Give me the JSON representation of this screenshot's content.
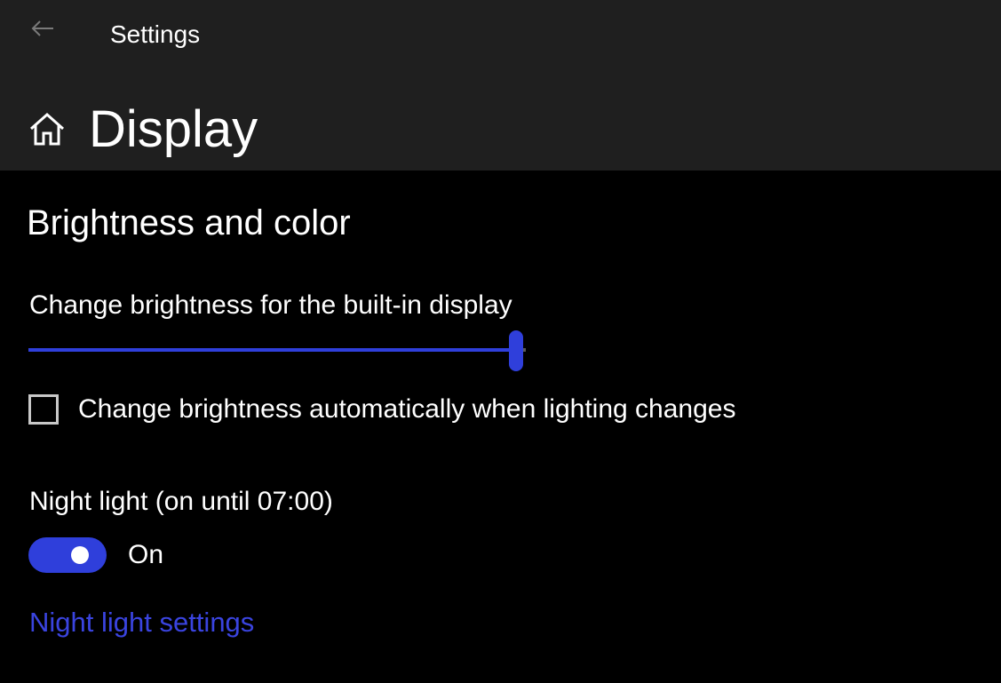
{
  "window": {
    "title": "Settings",
    "back_icon": "back-arrow-icon"
  },
  "header": {
    "home_icon": "home-icon",
    "page_title": "Display"
  },
  "brightness_section": {
    "heading": "Brightness and color",
    "brightness_label": "Change brightness for the built-in display",
    "brightness_level_fraction": 0.98,
    "auto_brightness_label": "Change brightness automatically when lighting changes",
    "auto_brightness_checked": false
  },
  "night_light": {
    "label": "Night light (on until 07:00)",
    "toggle_on": true,
    "toggle_state_label": "On",
    "settings_link": "Night light settings"
  },
  "colors": {
    "accent": "#2f3fdb",
    "link": "#3a44e0",
    "titlebar_bg": "#1f1f1f",
    "page_bg": "#000000"
  }
}
